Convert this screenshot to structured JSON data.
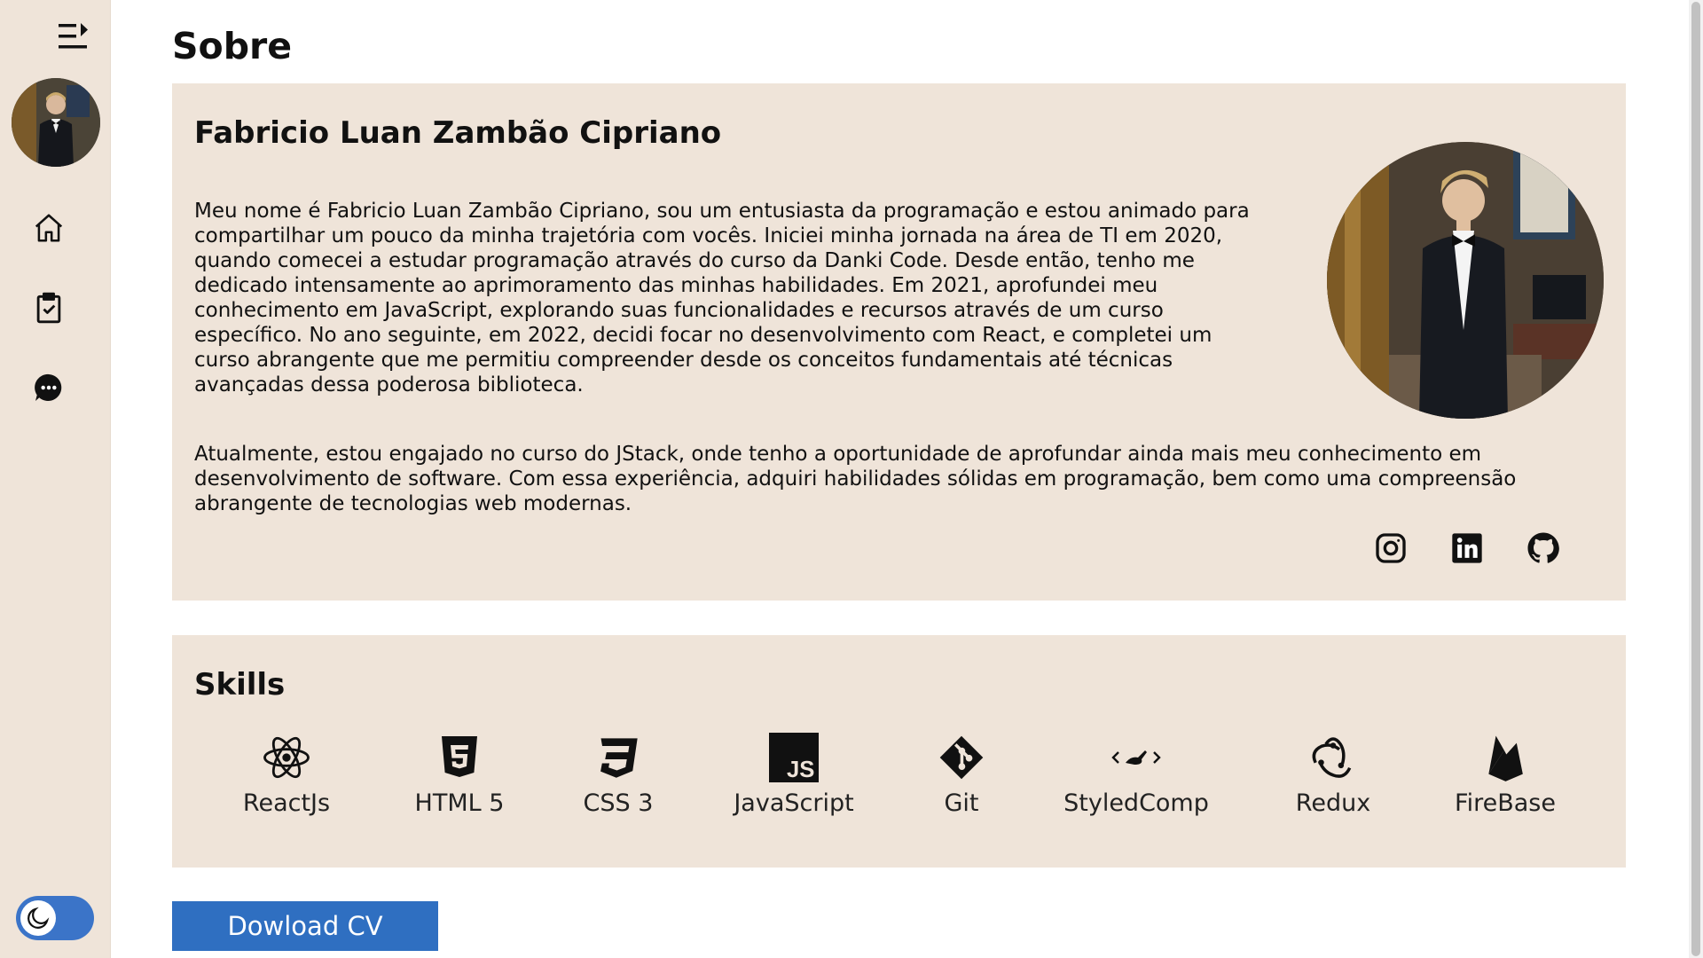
{
  "page": {
    "title": "Sobre"
  },
  "about": {
    "name": "Fabricio Luan Zambão Cipriano",
    "paragraph1": "Meu nome é Fabricio Luan Zambão Cipriano, sou um entusiasta da programação e estou animado para compartilhar um pouco da minha trajetória com vocês. Iniciei minha jornada na área de TI em 2020, quando comecei a estudar programação através do curso da Danki Code. Desde então, tenho me dedicado intensamente ao aprimoramento das minhas habilidades. Em 2021, aprofundei meu conhecimento em JavaScript, explorando suas funcionalidades e recursos através de um curso específico. No ano seguinte, em 2022, decidi focar no desenvolvimento com React, e completei um curso abrangente que me permitiu compreender desde os conceitos fundamentais até técnicas avançadas dessa poderosa biblioteca.",
    "paragraph2": "Atualmente, estou engajado no curso do JStack, onde tenho a oportunidade de aprofundar ainda mais meu conhecimento em desenvolvimento de software. Com essa experiência, adquiri habilidades sólidas em programação, bem como uma compreensão abrangente de tecnologias web modernas."
  },
  "social": [
    "instagram-icon",
    "linkedin-icon",
    "github-icon"
  ],
  "skills": {
    "title": "Skills",
    "items": [
      {
        "label": "ReactJs",
        "icon": "react-icon"
      },
      {
        "label": "HTML 5",
        "icon": "html5-icon"
      },
      {
        "label": "CSS 3",
        "icon": "css3-icon"
      },
      {
        "label": "JavaScript",
        "icon": "javascript-icon"
      },
      {
        "label": "Git",
        "icon": "git-icon"
      },
      {
        "label": "StyledComp",
        "icon": "styled-components-icon"
      },
      {
        "label": "Redux",
        "icon": "redux-icon"
      },
      {
        "label": "FireBase",
        "icon": "firebase-icon"
      }
    ]
  },
  "cv_button": {
    "label": "Dowload CV"
  },
  "sidebar": {
    "items": [
      "home-icon",
      "clipboard-check-icon",
      "chat-icon"
    ],
    "theme": "dark-mode-toggle"
  },
  "colors": {
    "card_bg": "#efe4d9",
    "accent": "#2f6fc1",
    "toggle": "#3b74c8"
  }
}
